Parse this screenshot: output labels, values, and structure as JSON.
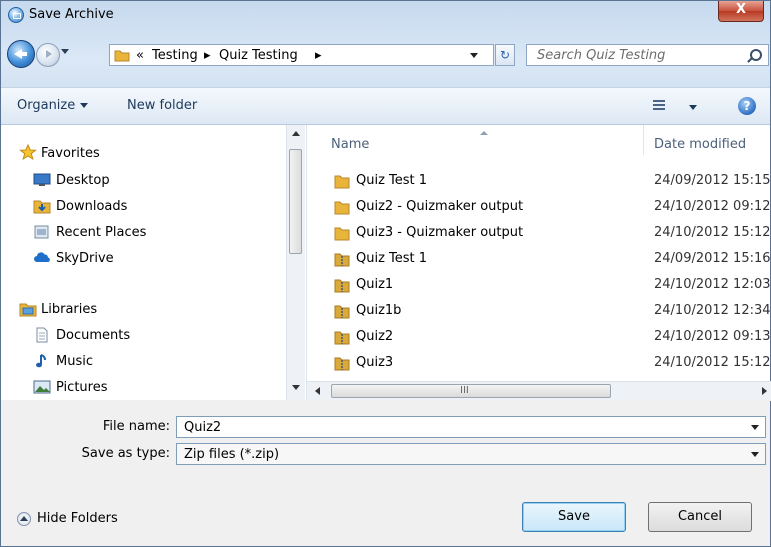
{
  "window": {
    "title": "Save Archive",
    "close_glyph": "X"
  },
  "nav": {
    "address_prefix": "«",
    "address_segments": [
      "Testing",
      "Quiz Testing"
    ],
    "separator": "▸",
    "search_placeholder": "Search Quiz Testing",
    "refresh_glyph": "↻"
  },
  "toolbar": {
    "organize_label": "Organize",
    "new_folder_label": "New folder",
    "help_glyph": "?"
  },
  "sidebar": {
    "favorites_label": "Favorites",
    "favorites": [
      "Desktop",
      "Downloads",
      "Recent Places",
      "SkyDrive"
    ],
    "libraries_label": "Libraries",
    "libraries": [
      "Documents",
      "Music",
      "Pictures"
    ]
  },
  "files": {
    "columns": {
      "name": "Name",
      "date": "Date modified"
    },
    "rows": [
      {
        "name": "Quiz Test 1",
        "date": "24/09/2012 15:15",
        "kind": "folder"
      },
      {
        "name": "Quiz2 - Quizmaker output",
        "date": "24/10/2012 09:12",
        "kind": "folder"
      },
      {
        "name": "Quiz3 - Quizmaker output",
        "date": "24/10/2012 15:12",
        "kind": "folder"
      },
      {
        "name": "Quiz Test 1",
        "date": "24/09/2012 15:16",
        "kind": "zip"
      },
      {
        "name": "Quiz1",
        "date": "24/10/2012 12:03",
        "kind": "zip"
      },
      {
        "name": "Quiz1b",
        "date": "24/10/2012 12:34",
        "kind": "zip"
      },
      {
        "name": "Quiz2",
        "date": "24/10/2012 09:13",
        "kind": "zip"
      },
      {
        "name": "Quiz3",
        "date": "24/10/2012 15:12",
        "kind": "zip"
      }
    ],
    "scroll_grip": "III"
  },
  "form": {
    "file_name_label": "File name:",
    "file_name_value": "Quiz2",
    "save_type_label": "Save as type:",
    "save_type_value": "Zip files (*.zip)"
  },
  "footer": {
    "hide_folders_label": "Hide Folders",
    "save_label": "Save",
    "cancel_label": "Cancel"
  },
  "colors": {
    "folder": "#e8b53a",
    "zip_folder": "#d9a93a",
    "accent": "#3c7fb1"
  }
}
